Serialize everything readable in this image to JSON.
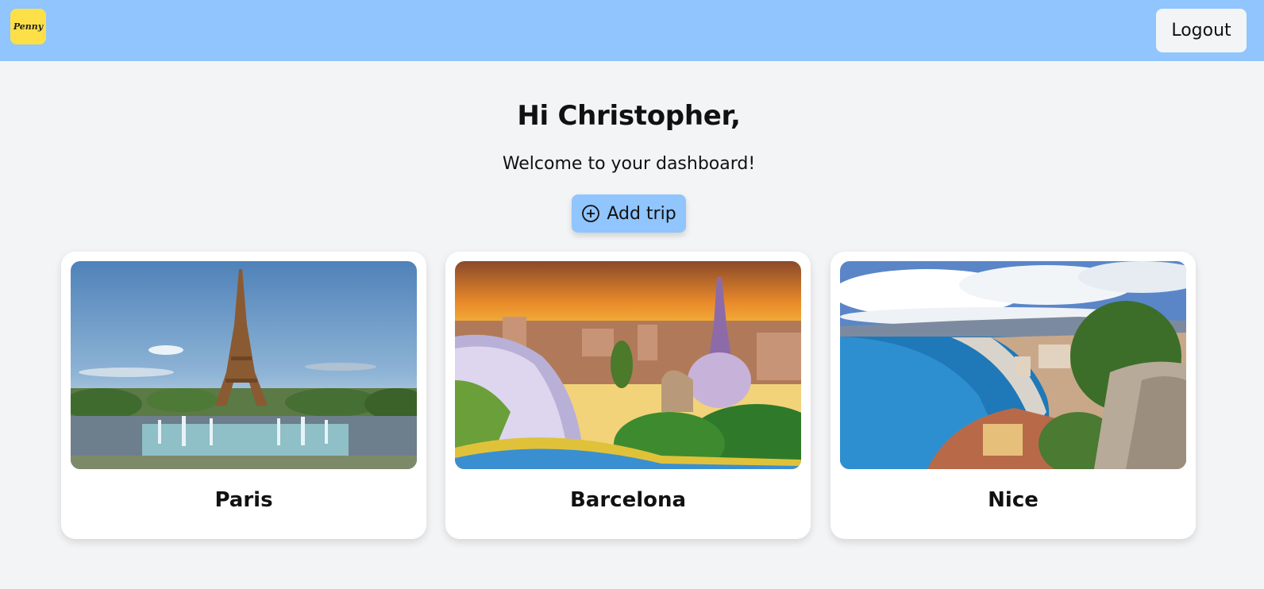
{
  "app": {
    "logo_text": "Penny"
  },
  "header": {
    "logout_label": "Logout"
  },
  "dashboard": {
    "greeting": "Hi Christopher,",
    "subtitle": "Welcome to your dashboard!",
    "add_trip_label": "Add trip",
    "add_trip_icon": "plus-circle-icon"
  },
  "trips": [
    {
      "name": "Paris"
    },
    {
      "name": "Barcelona"
    },
    {
      "name": "Nice"
    }
  ],
  "colors": {
    "navbar": "#90c5fd",
    "logo": "#fde047",
    "background": "#f3f4f6",
    "card": "#ffffff"
  }
}
